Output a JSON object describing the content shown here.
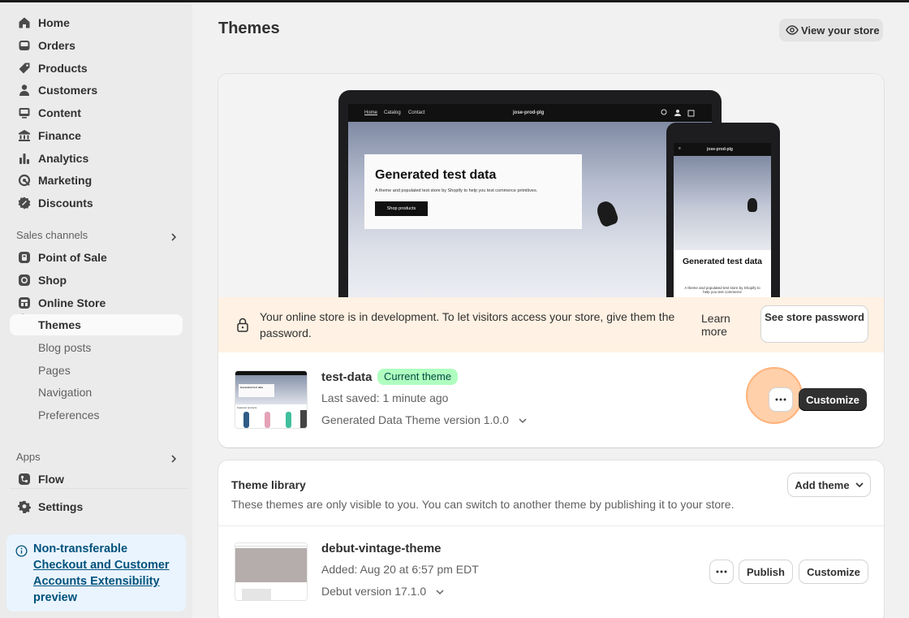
{
  "sidebar": {
    "nav": [
      {
        "label": "Home",
        "icon": "home-icon"
      },
      {
        "label": "Orders",
        "icon": "inbox-icon"
      },
      {
        "label": "Products",
        "icon": "tag-icon"
      },
      {
        "label": "Customers",
        "icon": "person-icon"
      },
      {
        "label": "Content",
        "icon": "content-icon"
      },
      {
        "label": "Finance",
        "icon": "bank-icon"
      },
      {
        "label": "Analytics",
        "icon": "bar-chart-icon"
      },
      {
        "label": "Marketing",
        "icon": "target-icon"
      },
      {
        "label": "Discounts",
        "icon": "discount-icon"
      }
    ],
    "sales_channels_label": "Sales channels",
    "channels": [
      {
        "label": "Point of Sale",
        "icon": "pos-icon"
      },
      {
        "label": "Shop",
        "icon": "shop-icon"
      },
      {
        "label": "Online Store",
        "icon": "store-icon"
      }
    ],
    "online_store_sub": [
      "Themes",
      "Blog posts",
      "Pages",
      "Navigation",
      "Preferences"
    ],
    "apps_label": "Apps",
    "apps": [
      {
        "label": "Flow",
        "icon": "flow-icon"
      }
    ],
    "settings_label": "Settings",
    "promo": {
      "line1": "Non-transferable",
      "link": "Checkout and Customer Accounts Extensibility",
      "line3": "preview"
    }
  },
  "header": {
    "title": "Themes",
    "view_store": "View your store"
  },
  "preview": {
    "desktop_nav": [
      "Home",
      "Catalog",
      "Contact"
    ],
    "store_name": "jose-prod-plg",
    "hero_heading": "Generated test data",
    "hero_text": "A theme and populated test store by Shopify to help you test commerce primitives.",
    "hero_button": "Shop products",
    "mobile_heading": "Generated test data",
    "mobile_text": "A theme and populated test store by Shopify to help you test commerce"
  },
  "banner": {
    "message": "Your online store is in development. To let visitors access your store, give them the password.",
    "learn_more": "Learn more",
    "see_password": "See store password"
  },
  "current_theme": {
    "name": "test-data",
    "badge": "Current theme",
    "saved": "Last saved: 1 minute ago",
    "version": "Generated Data Theme version 1.0.0",
    "customize": "Customize",
    "thumb_heading": "Generated test data",
    "thumb_section": "Featured products"
  },
  "library": {
    "title": "Theme library",
    "description": "These themes are only visible to you. You can switch to another theme by publishing it to your store.",
    "add_theme": "Add theme",
    "themes": [
      {
        "name": "debut-vintage-theme",
        "added": "Added: Aug 20 at 6:57 pm EDT",
        "version": "Debut version 17.1.0",
        "publish": "Publish",
        "customize": "Customize"
      }
    ]
  },
  "colors": {
    "badge_bg": "#affebf",
    "banner_bg": "#fff1e3",
    "promo_bg": "#eaf4ff",
    "highlight": "#ffb27a"
  }
}
